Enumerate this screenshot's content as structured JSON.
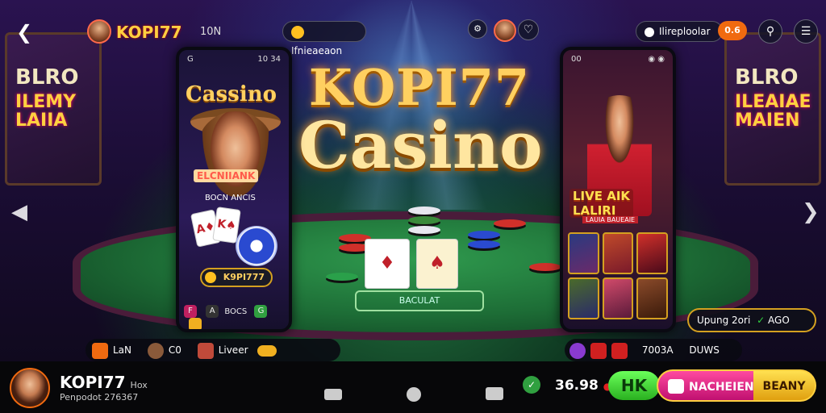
{
  "topbar": {
    "back_icon": "chevron-left-icon",
    "brand": "KOPI77",
    "brand_sub": "10N",
    "pill_center_left": "Ifnieaeaon",
    "pill_center_right": "Ilireploolar",
    "badge": "0.6"
  },
  "logo": {
    "line1": "KOPI77",
    "line2": "Casino"
  },
  "left_phone": {
    "status_left": "G",
    "status_right": "10 34",
    "title": "Cassino",
    "sign": "ELCNIIANK",
    "subtitle": "BOCN ANCIS",
    "code": "K9PI777",
    "bottom": [
      "F",
      "A",
      "BOCS",
      "G"
    ]
  },
  "right_phone": {
    "status": "00",
    "title": "LIVE AIK",
    "title2": "LALIRI",
    "subtitle": "LAUIA BAUEAIE"
  },
  "upcoming": {
    "label": "Upung 2ori",
    "value": "AGO"
  },
  "strip_left": [
    "LaN",
    "C0",
    "Liveer"
  ],
  "strip_right": [
    "7003A",
    "DUWS"
  ],
  "footer": {
    "name": "KOPI77",
    "name_tag": "Hox",
    "sub": "Penpodot 276367",
    "balance": "36.98",
    "hk": "HK",
    "macheten": "NACHEIEN",
    "beany": "BEANY"
  },
  "table": {
    "label": "BACULAT"
  },
  "colors": {
    "gold": "#ffd060",
    "green": "#30a040",
    "pink": "#c01070",
    "orange": "#f06a10"
  }
}
